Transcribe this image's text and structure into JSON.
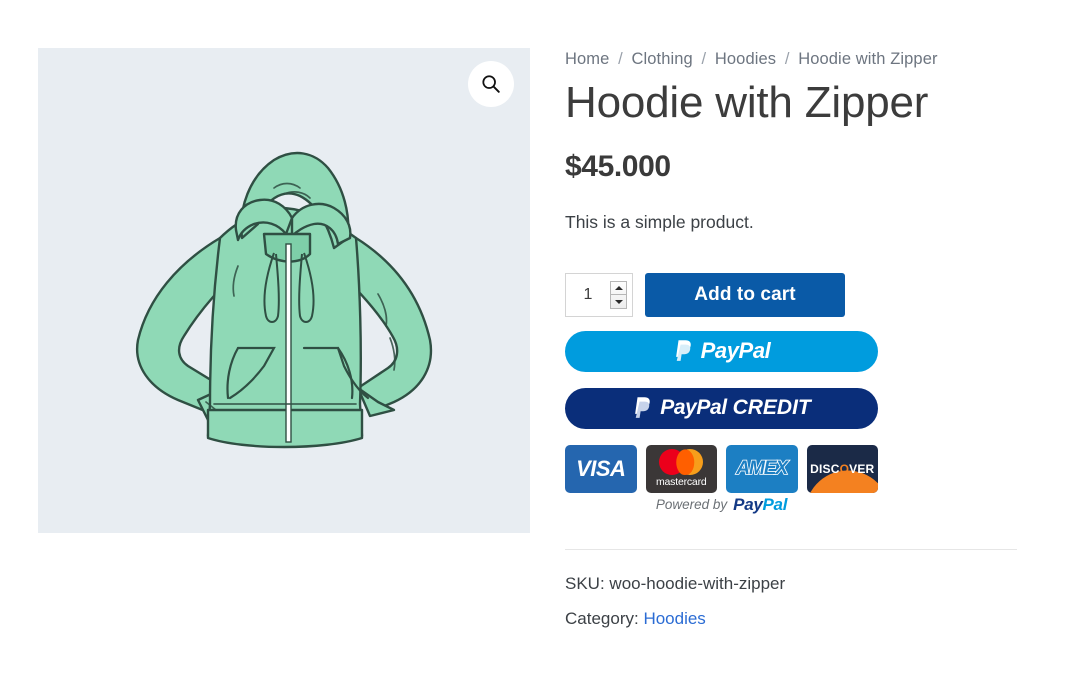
{
  "breadcrumb": {
    "items": [
      {
        "label": "Home",
        "link": true
      },
      {
        "label": "Clothing",
        "link": true
      },
      {
        "label": "Hoodies",
        "link": true
      },
      {
        "label": "Hoodie with Zipper",
        "link": false
      }
    ],
    "separator": "/"
  },
  "product": {
    "title": "Hoodie with Zipper",
    "price": "$45.000",
    "short_description": "This is a simple product.",
    "image_alt": "Mint green zip-up hoodie illustration",
    "image_background": "#e8edf2",
    "garment_color": "#8fd9b6"
  },
  "gallery": {
    "zoom_icon": "search-icon"
  },
  "cart": {
    "quantity_value": "1",
    "quantity_placeholder": "1",
    "spinner_up": "increase-quantity",
    "spinner_down": "decrease-quantity",
    "add_to_cart_label": "Add to cart",
    "add_to_cart_color": "#0a5aa7"
  },
  "paypal": {
    "paypal_button": {
      "brand": "PayPal",
      "background": "#009cde",
      "mark": "paypal-monogram-icon"
    },
    "credit_button": {
      "brand": "PayPal",
      "suffix": " CREDIT",
      "background": "#0a2e7a",
      "mark": "paypal-monogram-icon"
    },
    "cards": [
      {
        "name": "Visa",
        "label": "VISA",
        "background": "#2566af",
        "icon": "visa-card-icon"
      },
      {
        "name": "Mastercard",
        "label": "mastercard",
        "background": "#3b3737",
        "icon": "mastercard-card-icon"
      },
      {
        "name": "Amex",
        "label": "AMEX",
        "background": "#1c7fc3",
        "icon": "amex-card-icon"
      },
      {
        "name": "Discover",
        "label_pre": "DISC",
        "label_o": "O",
        "label_post": "VER",
        "background": "#1b2a47",
        "icon": "discover-card-icon"
      }
    ],
    "powered_by_label": "Powered by",
    "powered_brand_pay": "Pay",
    "powered_brand_pal": "Pal"
  },
  "meta": {
    "sku_label": "SKU:",
    "sku_value": "woo-hoodie-with-zipper",
    "category_label": "Category:",
    "category_value": "Hoodies"
  }
}
